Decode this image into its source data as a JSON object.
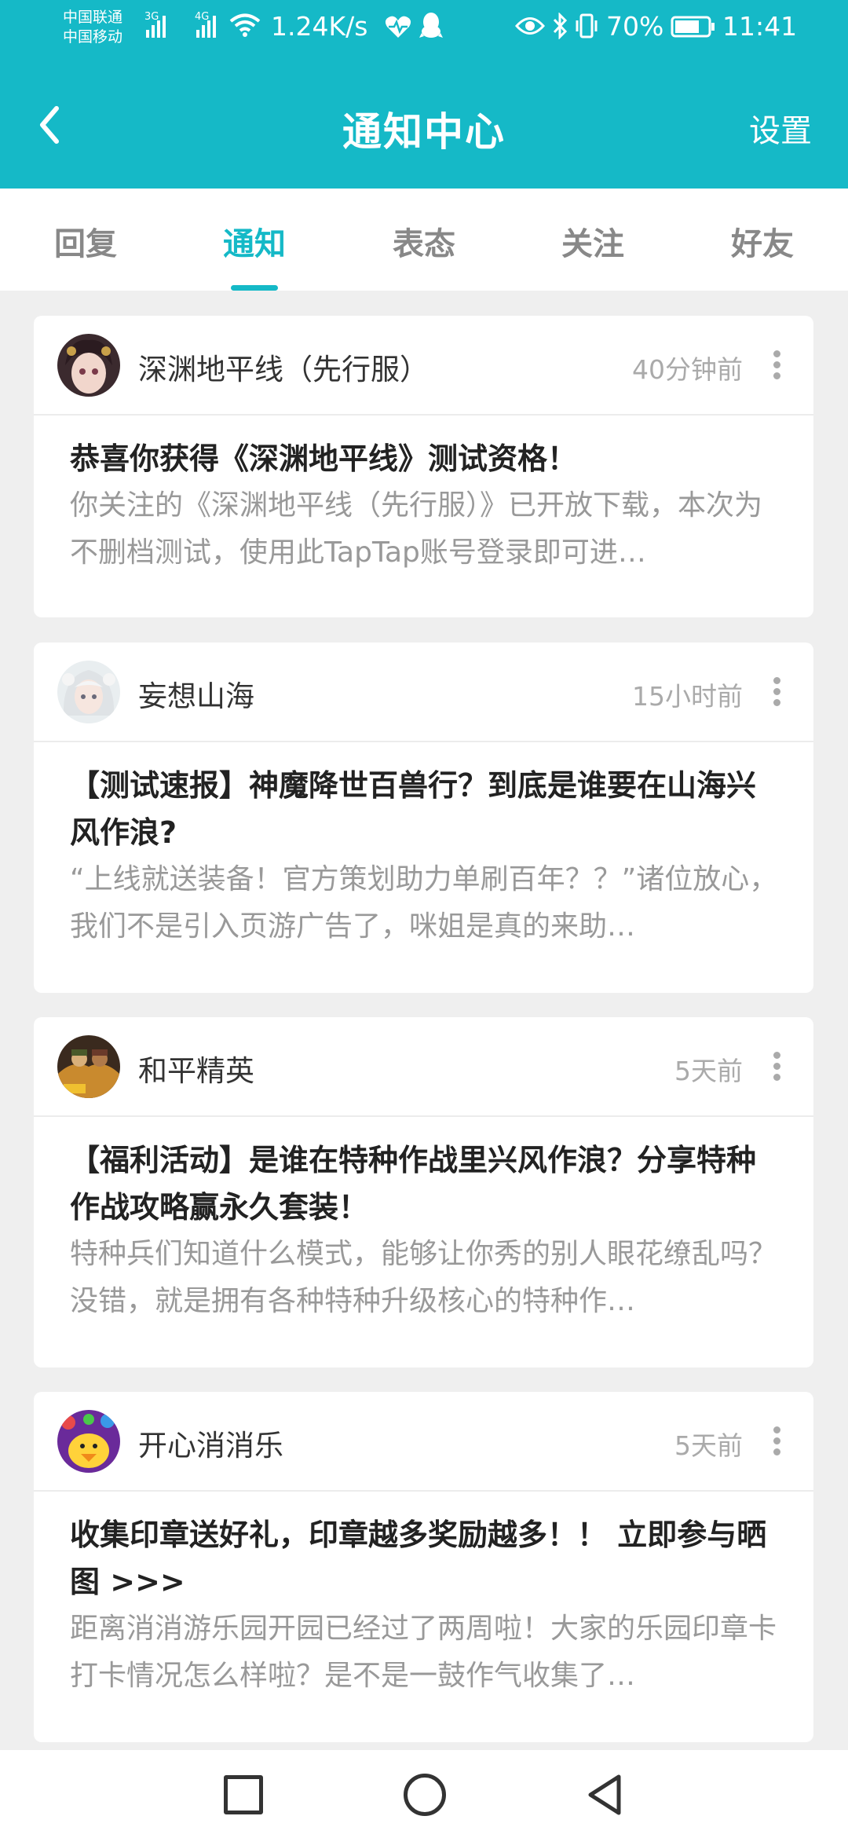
{
  "status_bar": {
    "carrier_1": "中国联通",
    "carrier_2": "中国移动",
    "signal_1_tech": "3G",
    "signal_2_tech": "4G",
    "net_speed": "1.24K/s",
    "battery": "70%",
    "time": "11:41"
  },
  "app_bar": {
    "title": "通知中心",
    "settings_label": "设置",
    "accent_color": "#15b9c7"
  },
  "tabs": [
    {
      "label": "回复"
    },
    {
      "label": "通知",
      "active": true
    },
    {
      "label": "表态"
    },
    {
      "label": "关注"
    },
    {
      "label": "好友"
    }
  ],
  "notifications": [
    {
      "source": "深渊地平线（先行服）",
      "time": "40分钟前",
      "title": "恭喜你获得《深渊地平线》测试资格！",
      "desc": "你关注的《深渊地平线（先行服）》已开放下载，本次为不删档测试，使用此TapTap账号登录即可进…"
    },
    {
      "source": "妄想山海",
      "time": "15小时前",
      "title": "【测试速报】神魔降世百兽行？到底是谁要在山海兴风作浪?",
      "desc": "“上线就送装备！官方策划助力单刷百年？？”诸位放心，我们不是引入页游广告了，咪姐是真的来助…"
    },
    {
      "source": "和平精英",
      "time": "5天前",
      "title": "【福利活动】是谁在特种作战里兴风作浪？分享特种作战攻略赢永久套装！",
      "desc": "特种兵们知道什么模式，能够让你秀的别人眼花缭乱吗？ 没错，就是拥有各种特种升级核心的特种作…"
    },
    {
      "source": "开心消消乐",
      "time": "5天前",
      "title": "收集印章送好礼，印章越多奖励越多！！ 立即参与晒图 >>>",
      "desc": "距离消消游乐园开园已经过了两周啦！大家的乐园印章卡打卡情况怎么样啦？是不是一鼓作气收集了…"
    }
  ]
}
